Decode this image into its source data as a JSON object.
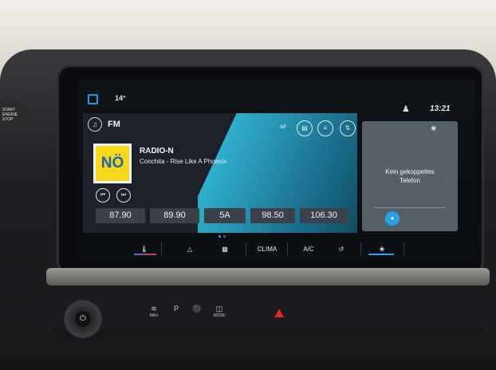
{
  "status_bar": {
    "temperature": "14°",
    "time": "13:21",
    "icons": [
      "home-square-icon",
      "person-seat-icon"
    ]
  },
  "radio": {
    "band": "FM",
    "af_label": "AF",
    "station_name": "RADIO-N",
    "now_playing": "Conchita - Rise Like A Phoenix",
    "logo_text": "NÖ",
    "presets": [
      "87.90",
      "89.90",
      "5A",
      "98.50",
      "106.30"
    ],
    "active_page": 1,
    "page_count": 2
  },
  "phone": {
    "message_line1": "Kein gekoppeltes",
    "message_line2": "Telefon"
  },
  "climate_bar": {
    "items": [
      {
        "name": "temperature-control",
        "label": ""
      },
      {
        "name": "windshield-defrost",
        "label": ""
      },
      {
        "name": "rear-defrost",
        "label": ""
      },
      {
        "name": "clima",
        "label": "CLIMA"
      },
      {
        "name": "ac",
        "label": "A/C"
      },
      {
        "name": "recirculation",
        "label": ""
      },
      {
        "name": "fan",
        "label": ""
      }
    ]
  },
  "physical_buttons": {
    "max_label": "MAX",
    "park_label": "P",
    "mode_label": "MODE"
  },
  "engine_button": {
    "line1": "START",
    "line2": "ENGINE",
    "line3": "STOP"
  },
  "colors": {
    "accent": "#1e9be8",
    "panel": "#1d2129",
    "teal": "#2fb0cd",
    "hazard": "#e0262c"
  }
}
